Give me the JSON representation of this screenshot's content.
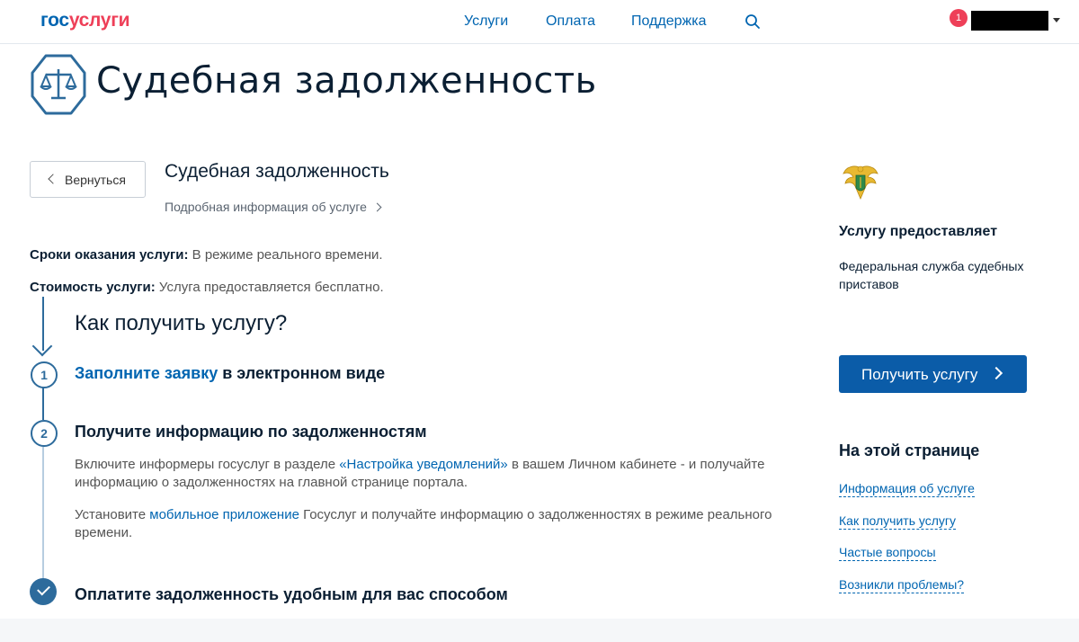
{
  "header": {
    "logo_part1": "гос",
    "logo_part2": "услуги",
    "nav": [
      {
        "label": "Услуги"
      },
      {
        "label": "Оплата"
      },
      {
        "label": "Поддержка"
      }
    ],
    "search_icon": "search-icon",
    "notification_count": "1",
    "user_name": ""
  },
  "hero": {
    "title": "Судебная задолженность",
    "icon": "scales-icon"
  },
  "service": {
    "back_label": "Вернуться",
    "title": "Судебная задолженность",
    "more_info": "Подробная информация об услуге",
    "term_label": "Сроки оказания услуги:",
    "term_value": " В режиме реального времени.",
    "cost_label": "Стоимость услуги:",
    "cost_value": " Услуга предоставляется бесплатно."
  },
  "how": {
    "title": "Как получить услугу?",
    "steps": [
      {
        "num": "1",
        "link": "Заполните заявку",
        "title": " в электронном виде"
      },
      {
        "num": "2",
        "title": "Получите информацию по задолженностям",
        "para1_a": "Включите информеры госуслуг в разделе ",
        "para1_link": "«Настройка уведомлений»",
        "para1_b": " в вашем Личном кабинете - и получайте информацию о задолженностях на главной странице портала.",
        "para2_a": "Установите ",
        "para2_link": "мобильное приложение",
        "para2_b": " Госуслуг и получайте информацию о задолженностях в режиме реального времени."
      },
      {
        "title": "Оплатите задолженность удобным для вас способом"
      }
    ]
  },
  "sidebar": {
    "emblem_icon": "fssp-emblem-icon",
    "provides_label": "Услугу предоставляет",
    "provider": "Федеральная служба судебных приставов",
    "get_button": "Получить услугу",
    "on_page_title": "На этой странице",
    "toc": [
      {
        "label": "Информация об услуге"
      },
      {
        "label": "Как получить услугу"
      },
      {
        "label": "Частые вопросы"
      },
      {
        "label": "Возникли проблемы?"
      }
    ]
  },
  "colors": {
    "brand_blue": "#0065b1",
    "brand_red": "#ee3f58",
    "button_blue": "#0b5ca8",
    "step_line": "#2d6b9c"
  }
}
